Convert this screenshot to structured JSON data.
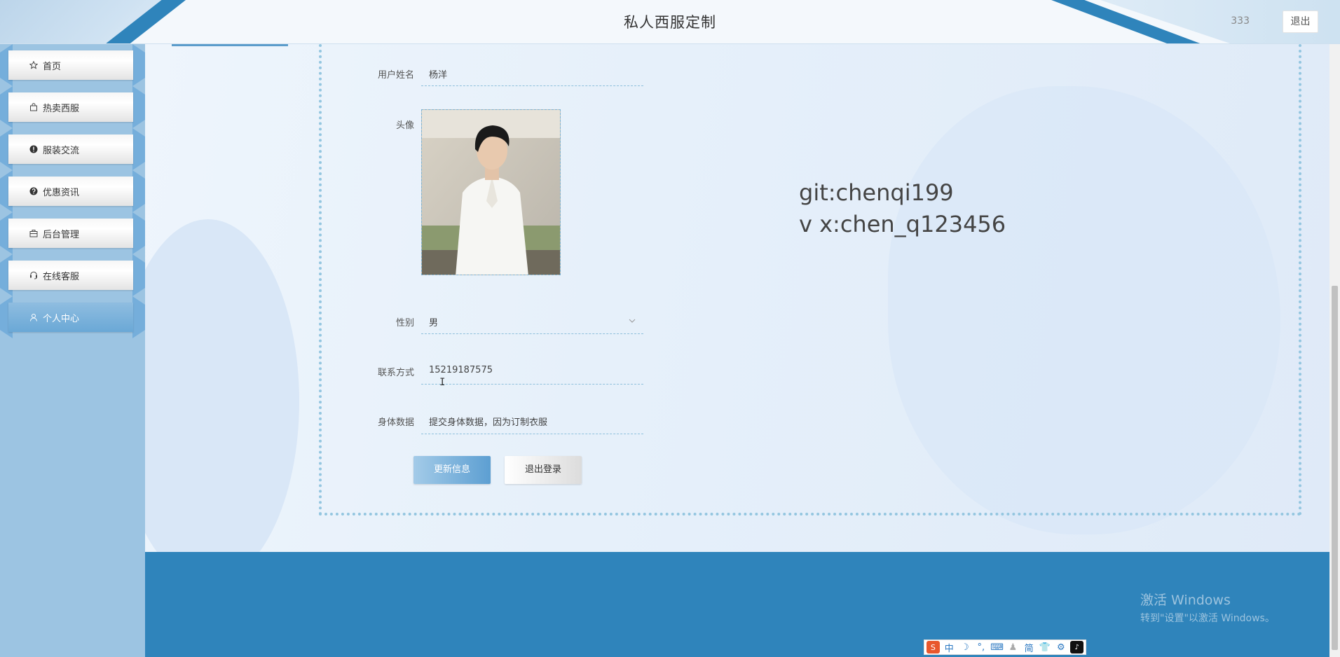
{
  "header": {
    "title": "私人西服定制",
    "username": "333",
    "logout_label": "退出"
  },
  "sidebar": {
    "items": [
      {
        "label": "首页",
        "icon": "star-icon"
      },
      {
        "label": "热卖西服",
        "icon": "shopping-bag-icon"
      },
      {
        "label": "服装交流",
        "icon": "exclamation-circle-icon"
      },
      {
        "label": "优惠资讯",
        "icon": "question-circle-icon"
      },
      {
        "label": "后台管理",
        "icon": "briefcase-icon"
      },
      {
        "label": "在线客服",
        "icon": "headset-icon"
      },
      {
        "label": "个人中心",
        "icon": "user-icon",
        "active": true
      }
    ]
  },
  "form": {
    "username_label": "用户姓名",
    "username_value": "杨洋",
    "avatar_label": "头像",
    "gender_label": "性别",
    "gender_value": "男",
    "contact_label": "联系方式",
    "contact_value": "15219187575",
    "body_label": "身体数据",
    "body_value": "提交身体数据，因为订制衣服",
    "update_button": "更新信息",
    "logout_button": "退出登录"
  },
  "overlay_text": {
    "line1": "git:chenqi199",
    "line2": "v x:chen_q123456"
  },
  "os": {
    "activate_title": "激活 Windows",
    "activate_sub": "转到\"设置\"以激活 Windows。",
    "ime_items": [
      "中",
      "简"
    ]
  },
  "colors": {
    "accent_blue": "#2f84bb",
    "sidebar_bg": "#9cc4e2",
    "active_nav": "#6aa8d6"
  }
}
